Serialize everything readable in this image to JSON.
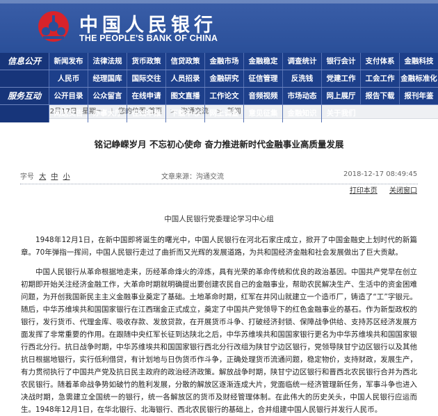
{
  "header": {
    "logo_cn": "中国人民银行",
    "logo_en": "THE PEOPLE'S BANK OF CHINA",
    "emblem_icon": "pboc-emblem-icon"
  },
  "nav": {
    "rows": [
      {
        "label": "信息公开",
        "items": [
          "新闻发布",
          "法律法规",
          "货币政策",
          "信贷政策",
          "金融市场",
          "金融稳定",
          "调查统计",
          "银行会计",
          "支付体系",
          "金融科技"
        ]
      },
      {
        "label": "",
        "items": [
          "人民币",
          "经理国库",
          "国际交往",
          "人员招录",
          "金融研究",
          "征信管理",
          "反洗钱",
          "党建工作",
          "工会工作",
          "金融标准化"
        ]
      },
      {
        "label": "服务互动",
        "items": [
          "公开目录",
          "公众留言",
          "在线申请",
          "图文直播",
          "工作论文",
          "音频视频",
          "市场动态",
          "网上展厅",
          "报告下载",
          "报刊年鉴"
        ]
      },
      {
        "label": "",
        "items": [
          "网送文告",
          "办事大厅",
          "在线申报",
          "下载中心",
          "网上调查",
          "意见征集",
          "金融知识",
          "关于我们"
        ]
      }
    ]
  },
  "breadcrumb": {
    "date": "2018年12月17日",
    "weekday": "星期一",
    "position_label": "您的位置:首页",
    "crumb1": "沟通交流",
    "crumb2": "新闻"
  },
  "article": {
    "title": "铭记峥嵘岁月 不忘初心使命 奋力推进新时代金融事业高质量发展",
    "font_label": "字号",
    "font_large": "大",
    "font_medium": "中",
    "font_small": "小",
    "source": "文章来源：沟通交流",
    "datetime": "2018-12-17 08:49:45",
    "print_label": "打印本页",
    "close_label": "关闭窗口",
    "byline": "中国人民银行党委理论学习中心组",
    "paragraphs": [
      "1948年12月1日，在新中国即将诞生的曙光中，中国人民银行在河北石家庄成立，掀开了中国金融史上划时代的新篇章。70年弹指一挥间，中国人民银行走过了曲折而又光辉的发展道路，为共和国经济金融和社会发展做出了巨大贡献。",
      "中国人民银行从革命根据地走来，历经革命烽火的淬炼，具有光荣的革命传统和优良的政治基因。中国共产党早在创立初期即开始关注经济金融工作，大革命时期就明确提出要创建农民自己的金融事业，帮助农民解决生产、生活中的资金困难问题，为开创我国新民主主义金融事业奠定了基础。土地革命时期，红军在井冈山就建立一个造币厂，铸造了“工”字银元。随后，中华苏维埃共和国国家银行在江西瑞金正式成立，奠定了中国共产党领导下的红色金融事业的基石。作为新型政权的银行，发行货币、代理金库、吸收存款、发放贷款，在开展货币斗争、打破经济封锁、保障战争供给、支持苏区经济发展方面发挥了非常重要的作用。在跟随中央红军长征到达陕北之后，中华苏维埃共和国国家银行更名为中华苏维埃共和国国家银行西北分行。抗日战争时期，中华苏维埃共和国国家银行西北分行改组为陕甘宁边区银行，党领导陕甘宁边区银行以及其他抗日根据地银行，实行低利借贷，有计划地与日伪货币作斗争，正确处理货币流通问题，稳定物价，支持财政，发展生产，有力贯彻执行了中国共产党及抗日民主政府的政治经济政策。解放战争时期，陕甘宁边区银行和晋西北农民银行合并为西北农民银行。随着革命战争势如破竹的胜利发展，分散的解放区逐渐连成大片，党面临统一经济管理新任务，军事斗争也进入决战时期，急需建立全国统一的银行，统一各解放区的货币及财经管理体制。在此伟大的历史关头，中国人民银行应运而生。1948年12月1日，在华北银行、北海银行、西北农民银行的基础上，合并组建中国人民银行并发行人民币。"
    ]
  },
  "colors": {
    "header_blue": "#2a4f99",
    "nav_blue": "#1d3f8a",
    "emblem_red": "#d8232a"
  }
}
